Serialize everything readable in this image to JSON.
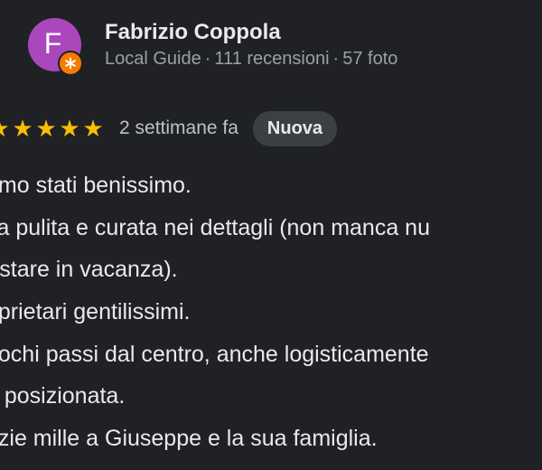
{
  "review": {
    "author": {
      "avatar_letter": "F",
      "name": "Fabrizio Coppola",
      "badge_icon": "local-guide-star-icon",
      "meta": [
        "Local Guide",
        "111 recensioni",
        "57 foto"
      ],
      "meta_separator": "·"
    },
    "rating": {
      "stars": 5,
      "max_stars": 5
    },
    "date": "2 settimane fa",
    "status_badge": "Nuova",
    "lines": [
      "amo stati benissimo.",
      "sa pulita e curata nei dettagli (non manca nu",
      "r stare in vacanza).",
      "oprietari gentilissimi.",
      "pochi passi dal centro, anche logisticamente",
      "n posizionata.",
      "azie mille a Giuseppe e la sua famiglia."
    ]
  },
  "colors": {
    "background": "#202124",
    "avatar": "#ab47bc",
    "guide_badge": "#f57c00",
    "star": "#fbbc04",
    "badge_bg": "#3c4043"
  }
}
